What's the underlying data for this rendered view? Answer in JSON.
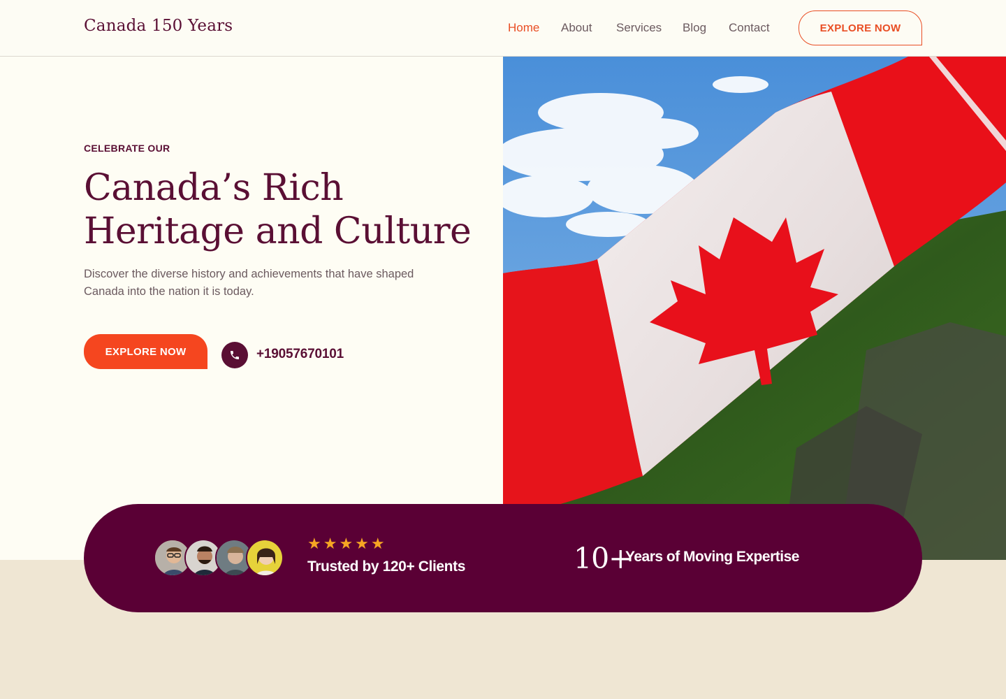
{
  "header": {
    "brand": "Canada 150 Years",
    "nav": [
      {
        "label": "Home",
        "active": true
      },
      {
        "label": "About",
        "active": false
      },
      {
        "label": "Services",
        "active": false
      },
      {
        "label": "Blog",
        "active": false
      },
      {
        "label": "Contact",
        "active": false
      }
    ],
    "cta_label": "EXPLORE NOW"
  },
  "hero": {
    "eyebrow": "CELEBRATE OUR",
    "headline_line1": "Canada’s Rich",
    "headline_line2": "Heritage and Culture",
    "description": "Discover the diverse history and achievements that have shaped Canada into the nation it is today.",
    "cta_label": "EXPLORE NOW",
    "phone": "+19057670101",
    "image_icon": "canada-flag-photo"
  },
  "stats": {
    "stars": "★★★★★",
    "rating": 5,
    "trusted_text": "Trusted by 120+ Clients",
    "years_number": "10+",
    "years_text": "Years of Moving Expertise",
    "avatars": [
      "client-avatar-1",
      "client-avatar-2",
      "client-avatar-3",
      "client-avatar-4"
    ]
  },
  "colors": {
    "brand": "#5a0f34",
    "accent": "#f5461f",
    "stats_bg": "#5a0035",
    "page_bg": "#fefdf4",
    "band_bg": "#efe6d3",
    "star": "#f5a623"
  }
}
